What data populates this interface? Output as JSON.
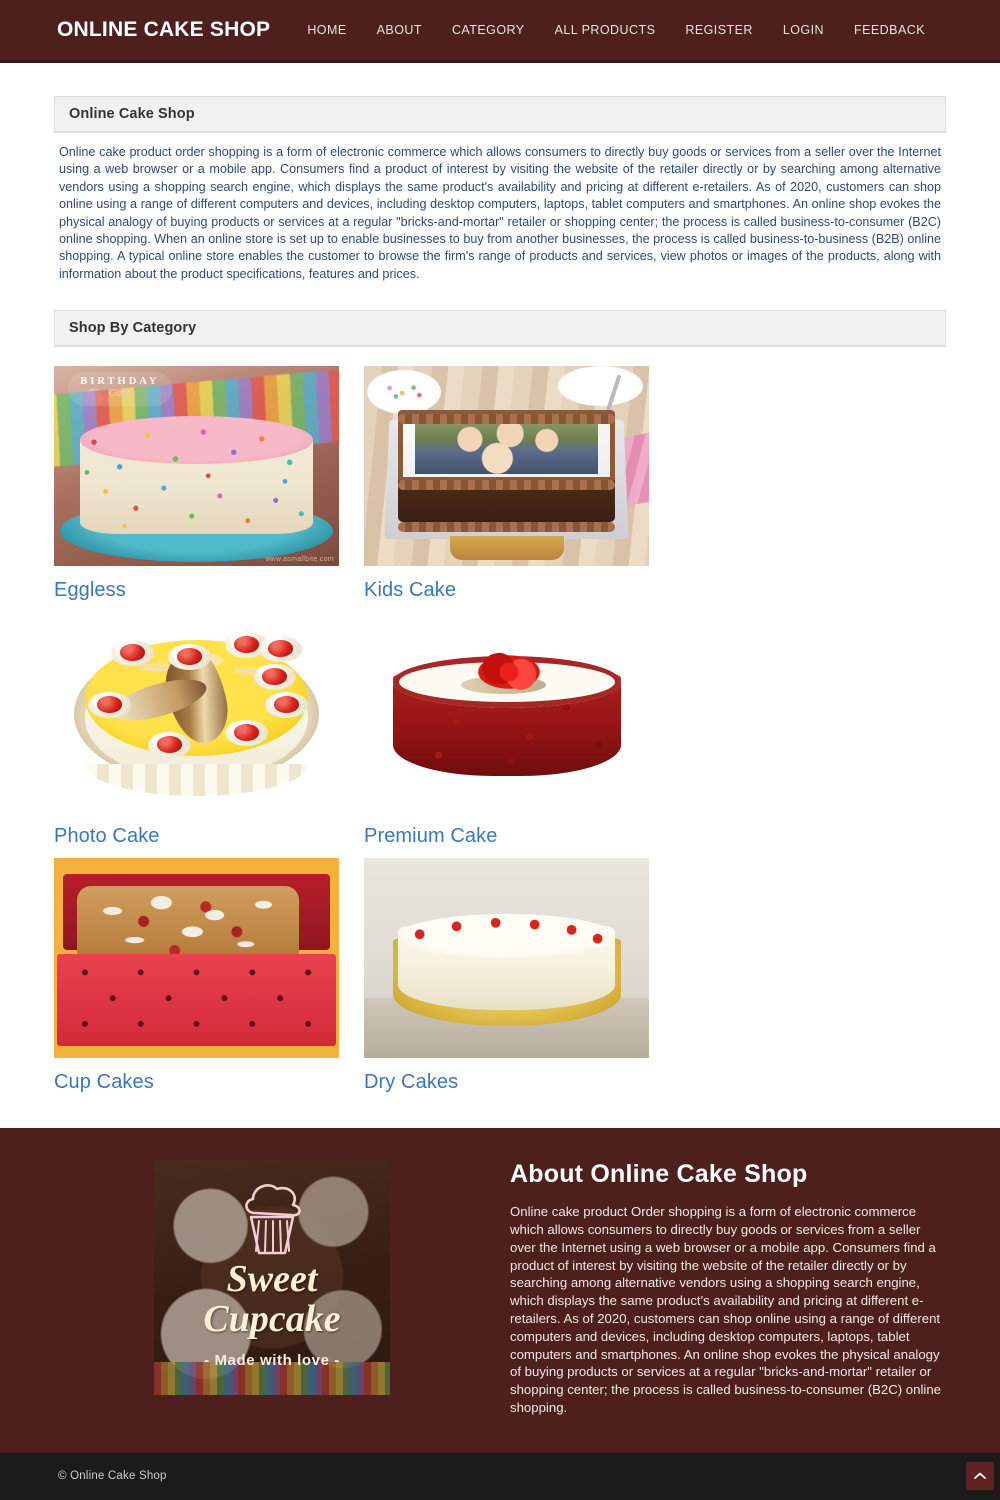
{
  "header": {
    "brand": "ONLINE CAKE SHOP",
    "brand_color": "#4d201d",
    "nav": [
      {
        "label": "HOME",
        "name": "nav-home"
      },
      {
        "label": "ABOUT",
        "name": "nav-about"
      },
      {
        "label": "CATEGORY",
        "name": "nav-category"
      },
      {
        "label": "ALL PRODUCTS",
        "name": "nav-all-products"
      },
      {
        "label": "REGISTER",
        "name": "nav-register"
      },
      {
        "label": "LOGIN",
        "name": "nav-login"
      },
      {
        "label": "FEEDBACK",
        "name": "nav-feedback"
      }
    ]
  },
  "intro_panel": {
    "title": "Online Cake Shop",
    "body": "Online cake product order shopping is a form of electronic commerce which allows consumers to directly buy goods or services from a seller over the Internet using a web browser or a mobile app. Consumers find a product of interest by visiting the website of the retailer directly or by searching among alternative vendors using a shopping search engine, which displays the same product's availability and pricing at different e-retailers. As of 2020, customers can shop online using a range of different computers and devices, including desktop computers, laptops, tablet computers and smartphones. An online shop evokes the physical analogy of buying products or services at a regular \"bricks-and-mortar\" retailer or shopping center; the process is called business-to-consumer (B2C) online shopping. When an online store is set up to enable businesses to buy from another businesses, the process is called business-to-business (B2B) online shopping. A typical online store enables the customer to browse the firm's range of products and services, view photos or images of the products, along with information about the product specifications, features and prices."
  },
  "category_panel": {
    "title": "Shop By Category",
    "link_color": "#3b76bd",
    "items": [
      {
        "label": "Eggless",
        "image_alt": "birthday-cake-with-sprinkles",
        "badge_line1": "BIRTHDAY",
        "badge_line2": "Cake",
        "watermark": "www.asmallbite.com"
      },
      {
        "label": "Kids Cake",
        "image_alt": "chocolate-photo-cake-with-family-picture"
      },
      {
        "label": "Photo Cake",
        "image_alt": "yellow-pineapple-cake-with-cherries"
      },
      {
        "label": "Premium Cake",
        "image_alt": "red-velvet-cake-with-rose"
      },
      {
        "label": "Cup Cakes",
        "image_alt": "dry-fruit-cake-in-red-polka-dot-box"
      },
      {
        "label": "Dry Cakes",
        "image_alt": "pineapple-cream-cake-with-cherries"
      }
    ]
  },
  "about": {
    "title": "About Online Cake Shop",
    "body": "Online cake product Order shopping is a form of electronic commerce which allows consumers to directly buy goods or services from a seller over the Internet using a web browser or a mobile app. Consumers find a product of interest by visiting the website of the retailer directly or by searching among alternative vendors using a shopping search engine, which displays the same product's availability and pricing at different e-retailers. As of 2020, customers can shop online using a range of different computers and devices, including desktop computers, laptops, tablet computers and smartphones. An online shop evokes the physical analogy of buying products or services at a regular \"bricks-and-mortar\" retailer or shopping center; the process is called business-to-consumer (B2C) online shopping.",
    "promo": {
      "title_line1": "Sweet",
      "title_line2": "Cupcake",
      "tagline": "- Made with love -",
      "icon": "cupcake-icon"
    }
  },
  "footer": {
    "copyright": "© Online Cake Shop",
    "to_top_icon": "chevron-up-icon",
    "background": "#1b1b1b"
  }
}
